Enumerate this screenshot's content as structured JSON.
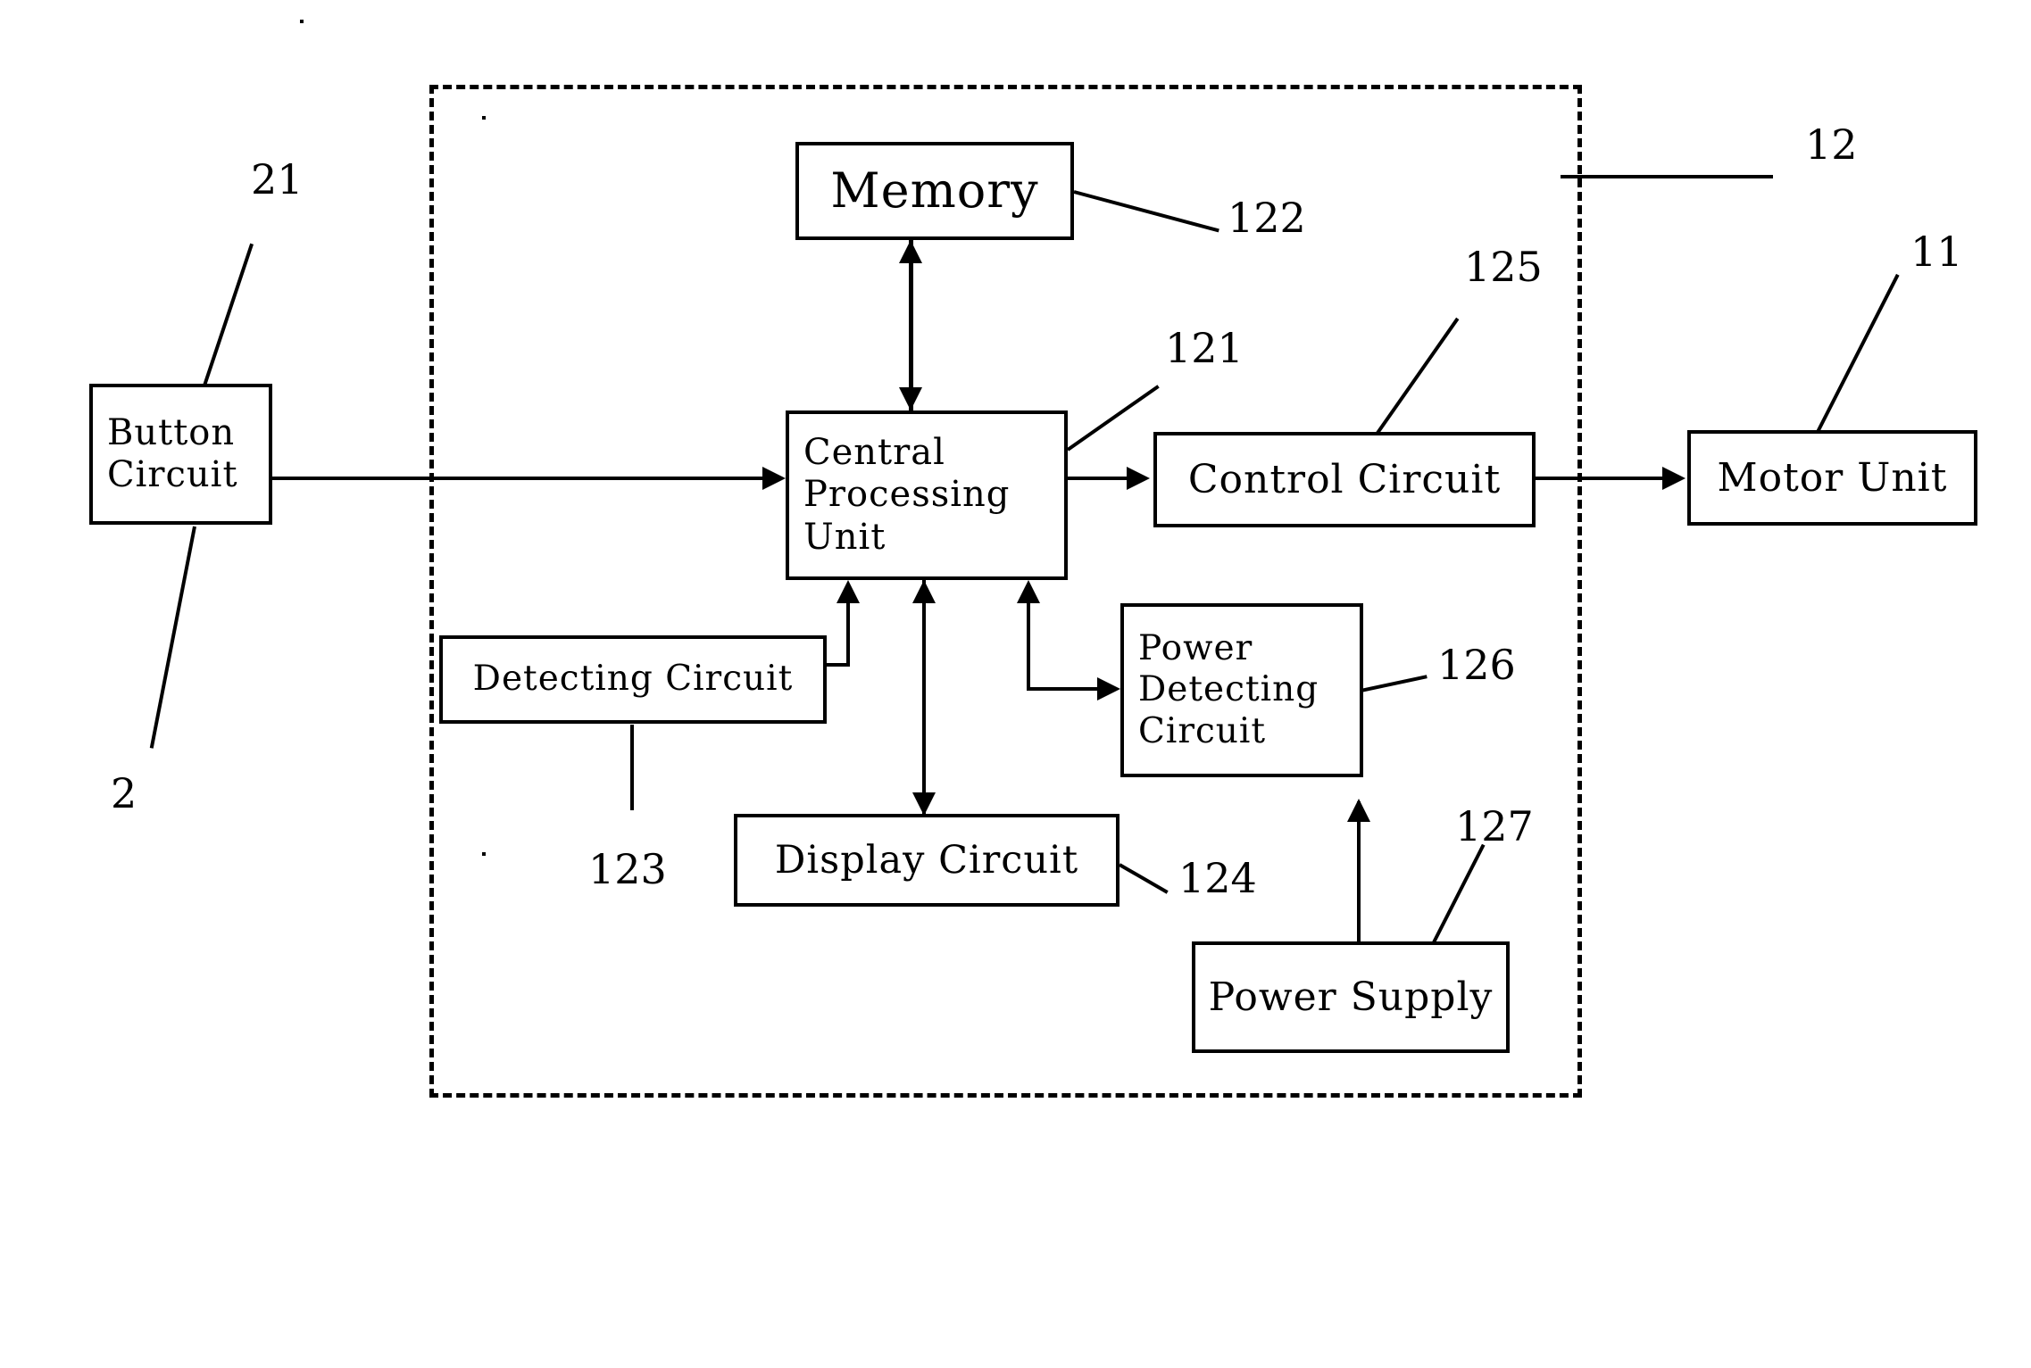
{
  "figure": {
    "type": "patent-block-diagram",
    "blocks": [
      {
        "id": "button-circuit",
        "label": "Button\nCircuit"
      },
      {
        "id": "memory",
        "label": "Memory"
      },
      {
        "id": "central-processing-unit",
        "label": "Central\nProcessing\nUnit"
      },
      {
        "id": "control-circuit",
        "label": "Control Circuit"
      },
      {
        "id": "motor-unit",
        "label": "Motor Unit"
      },
      {
        "id": "detecting-circuit",
        "label": "Detecting Circuit"
      },
      {
        "id": "display-circuit",
        "label": "Display Circuit"
      },
      {
        "id": "power-detecting-circuit",
        "label": "Power\nDetecting\nCircuit"
      },
      {
        "id": "power-supply",
        "label": "Power Supply"
      }
    ],
    "reference_numerals": [
      {
        "id": "ref-21",
        "value": "21"
      },
      {
        "id": "ref-2",
        "value": "2"
      },
      {
        "id": "ref-122",
        "value": "122"
      },
      {
        "id": "ref-121",
        "value": "121"
      },
      {
        "id": "ref-125",
        "value": "125"
      },
      {
        "id": "ref-12",
        "value": "12"
      },
      {
        "id": "ref-11",
        "value": "11"
      },
      {
        "id": "ref-126",
        "value": "126"
      },
      {
        "id": "ref-127",
        "value": "127"
      },
      {
        "id": "ref-123",
        "value": "123"
      },
      {
        "id": "ref-124",
        "value": "124"
      }
    ],
    "colors": {
      "stroke": "#000000",
      "background": "#ffffff"
    }
  }
}
